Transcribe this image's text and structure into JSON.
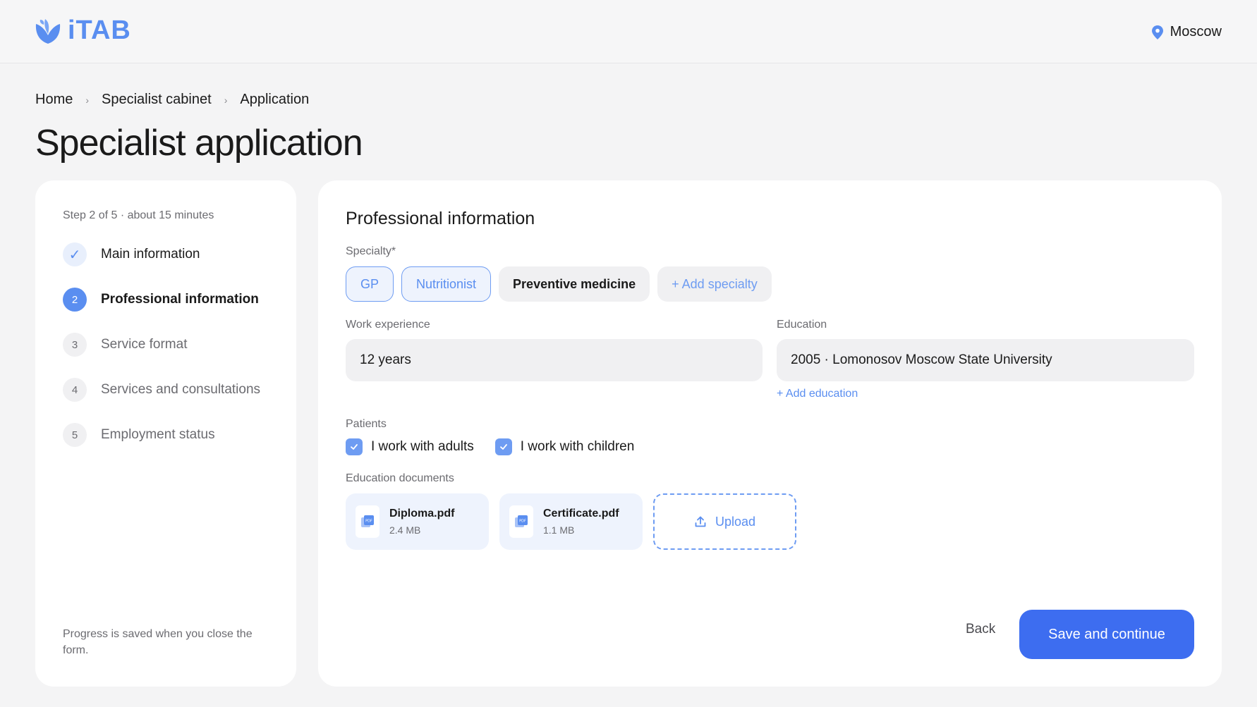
{
  "header": {
    "logo_text": "iTAB",
    "city": "Moscow"
  },
  "breadcrumb": [
    "Home",
    "Specialist cabinet",
    "Application"
  ],
  "page_title": "Specialist application",
  "steps": {
    "meta": "Step 2 of 5 · about 15 minutes",
    "items": [
      {
        "num": "✓",
        "label": "Main information",
        "state": "done"
      },
      {
        "num": "2",
        "label": "Professional information",
        "state": "active"
      },
      {
        "num": "3",
        "label": "Service format",
        "state": "pending"
      },
      {
        "num": "4",
        "label": "Services and consultations",
        "state": "pending"
      },
      {
        "num": "5",
        "label": "Employment status",
        "state": "pending"
      }
    ],
    "footer": "Progress is saved when you close the form."
  },
  "form": {
    "title": "Professional information",
    "specialty_label": "Specialty*",
    "specialties": [
      {
        "label": "GP",
        "selected": true
      },
      {
        "label": "Nutritionist",
        "selected": true
      },
      {
        "label": "Preventive medicine",
        "selected": false
      }
    ],
    "add_specialty": "+ Add specialty",
    "experience_label": "Work experience",
    "experience_value": "12 years",
    "education_label": "Education",
    "education_value": "2005 · Lomonosov Moscow State University",
    "add_education": "+ Add education",
    "patients_label": "Patients",
    "patients": [
      {
        "label": "I work with adults",
        "checked": true
      },
      {
        "label": "I work with children",
        "checked": true
      }
    ],
    "documents_label": "Education documents",
    "documents": [
      {
        "name": "Diploma.pdf",
        "size": "2.4 MB"
      },
      {
        "name": "Certificate.pdf",
        "size": "1.1 MB"
      }
    ],
    "upload_label": "Upload",
    "back_label": "Back",
    "save_label": "Save and continue"
  },
  "colors": {
    "accent": "#5a8ef0",
    "primary_button": "#3d6df0",
    "background": "#f4f4f5"
  }
}
